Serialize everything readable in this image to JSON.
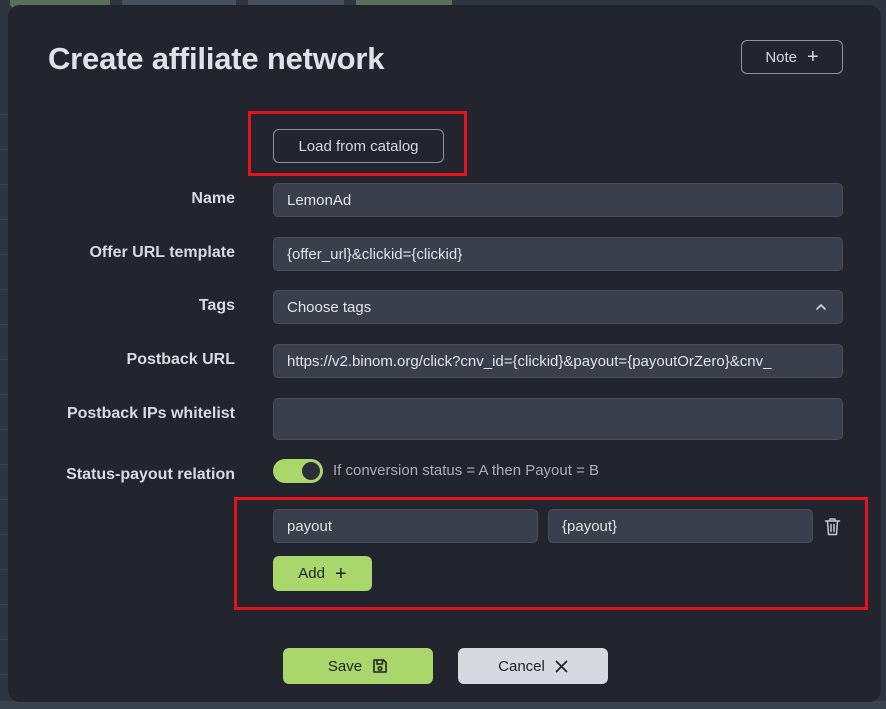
{
  "modal": {
    "title": "Create affiliate network",
    "note_label": "Note"
  },
  "catalog": {
    "label": "Load from catalog"
  },
  "fields": {
    "name": {
      "label": "Name",
      "value": "LemonAd"
    },
    "offer_url": {
      "label": "Offer URL template",
      "value": "{offer_url}&clickid={clickid}"
    },
    "tags": {
      "label": "Tags",
      "placeholder": "Choose tags"
    },
    "postback_url": {
      "label": "Postback URL",
      "value": "https://v2.binom.org/click?cnv_id={clickid}&payout={payoutOrZero}&cnv_"
    },
    "postback_ips": {
      "label": "Postback IPs whitelist",
      "value": ""
    },
    "status_payout": {
      "label": "Status-payout relation",
      "enabled": true,
      "hint": "If conversion status = A then Payout = B"
    }
  },
  "relation": {
    "status_value": "payout",
    "payout_value": "{payout}",
    "add_label": "Add"
  },
  "footer": {
    "save_label": "Save",
    "cancel_label": "Cancel"
  },
  "colors": {
    "accent": "#a9d76b",
    "highlight": "#e5141c",
    "surface": "#22252e",
    "input": "#3b3e4b"
  }
}
